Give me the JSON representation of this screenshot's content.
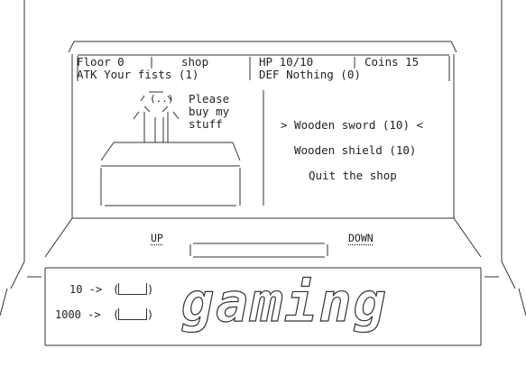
{
  "status": {
    "floor": "Floor 0",
    "location": "shop",
    "hp": "HP 10/10",
    "coins": "Coins 15",
    "atk": "ATK Your fists (1)",
    "def": "DEF Nothing (0)"
  },
  "shopkeeper": {
    "speech": [
      "Please",
      "buy my",
      "stuff"
    ]
  },
  "menu": {
    "items": [
      {
        "label": "> Wooden sword (10) <",
        "selected": true
      },
      {
        "label": "Wooden shield (10)",
        "selected": false
      },
      {
        "label": "Quit the shop",
        "selected": false
      }
    ]
  },
  "controls": {
    "up_label": "UP",
    "down_label": "DOWN"
  },
  "coin_slots": [
    {
      "label": "10 ->"
    },
    {
      "label": "1000 ->"
    }
  ],
  "brand": {
    "text": "gaming",
    "icon": "ascii-logo"
  }
}
